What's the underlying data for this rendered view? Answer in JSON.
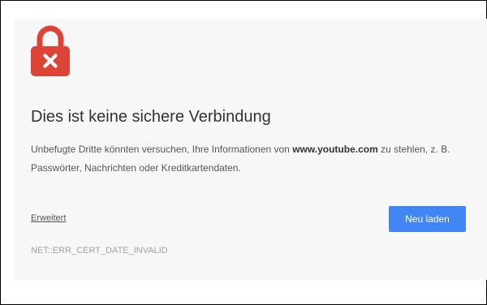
{
  "interstitial": {
    "title": "Dies ist keine sichere Verbindung",
    "desc_before": "Unbefugte Dritte könnten versuchen, Ihre Informationen von ",
    "domain": "www.youtube.com",
    "desc_after": " zu stehlen, z. B. Passwörter, Nachrichten oder Kreditkartendaten.",
    "advanced_link": "Erweitert",
    "reload_button": "Neu laden",
    "error_code": "NET::ERR_CERT_DATE_INVALID",
    "icon": "lock-error-icon"
  },
  "colors": {
    "lock_red": "#db4437",
    "button_blue": "#4285f4",
    "panel_bg": "#f7f7f7"
  }
}
